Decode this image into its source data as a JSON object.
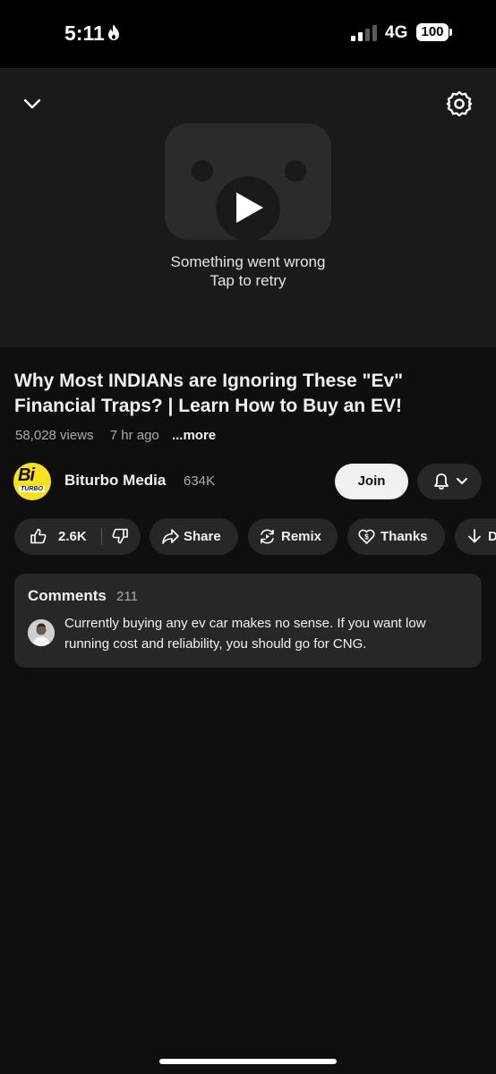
{
  "status_bar": {
    "time": "5:11",
    "network": "4G",
    "battery": "100"
  },
  "player": {
    "error_line1": "Something went wrong",
    "error_line2": "Tap to retry"
  },
  "video": {
    "title": "Why Most INDIANs are Ignoring These \"Ev\" Financial Traps? | Learn How to Buy an EV!",
    "views": "58,028 views",
    "age": "7 hr ago",
    "more": "...more"
  },
  "channel": {
    "name": "Biturbo Media",
    "subscribers": "634K",
    "avatar_text": "Bi",
    "avatar_subtext": "TURBO",
    "join_label": "Join"
  },
  "actions": {
    "likes": "2.6K",
    "share": "Share",
    "remix": "Remix",
    "thanks": "Thanks",
    "download": "D"
  },
  "comments": {
    "header": "Comments",
    "count": "211",
    "top_comment": "Currently buying any ev car makes no sense. If you want low running cost and reliability, you should go for CNG."
  },
  "colors": {
    "background": "#0f0f0f",
    "chip": "#272727",
    "accent_yellow": "#f7e21c"
  },
  "icons": [
    "flame-icon",
    "signal-icon",
    "chevron-down-icon",
    "gear-icon",
    "play-icon",
    "bell-icon",
    "thumbs-up-icon",
    "thumbs-down-icon",
    "share-icon",
    "remix-icon",
    "thanks-icon",
    "download-icon"
  ]
}
